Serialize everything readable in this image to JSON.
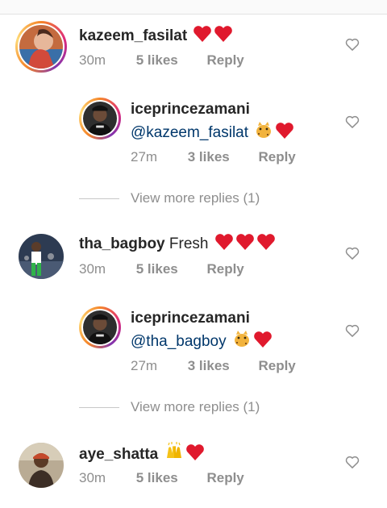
{
  "colors": {
    "heart_emoji": "#e0192d",
    "mention": "#00376b",
    "meta_gray": "#8e8e8e",
    "text": "#262626"
  },
  "comments": [
    {
      "username": "kazeem_fasilat",
      "text": "",
      "emojis": [
        "red-heart",
        "red-heart"
      ],
      "time": "30m",
      "likes": "5 likes",
      "reply": "Reply",
      "replies": [
        {
          "username": "iceprincezamani",
          "mention": "@kazeem_fasilat",
          "emojis": [
            "leopard",
            "red-heart"
          ],
          "time": "27m",
          "likes": "3 likes",
          "reply": "Reply"
        }
      ],
      "view_more": "View more replies (1)"
    },
    {
      "username": "tha_bagboy",
      "text": "Fresh",
      "emojis": [
        "red-heart",
        "red-heart",
        "red-heart"
      ],
      "time": "30m",
      "likes": "5 likes",
      "reply": "Reply",
      "replies": [
        {
          "username": "iceprincezamani",
          "mention": "@tha_bagboy",
          "emojis": [
            "leopard",
            "red-heart"
          ],
          "time": "27m",
          "likes": "3 likes",
          "reply": "Reply"
        }
      ],
      "view_more": "View more replies (1)"
    },
    {
      "username": "aye_shatta",
      "text": "",
      "emojis": [
        "raising-hands",
        "red-heart"
      ],
      "time": "30m",
      "likes": "5 likes",
      "reply": "Reply"
    }
  ]
}
